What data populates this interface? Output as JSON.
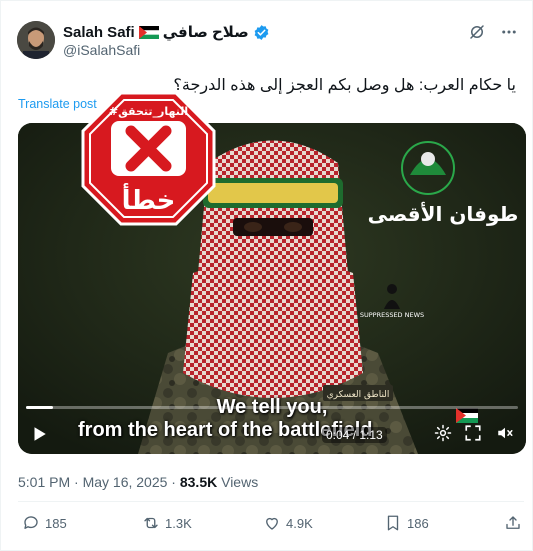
{
  "author": {
    "display_name": "Salah Safi",
    "arabic_name": "صلاح صافي",
    "handle": "@iSalahSafi",
    "verified": true,
    "flag_icon": "palestine-flag-icon"
  },
  "post": {
    "text": "يا حكام العرب: هل وصل بكم العجز إلى هذه الدرجة؟",
    "translate_label": "Translate post",
    "timestamp": "5:01 PM · May 16, 2025 ·",
    "views_count": "83.5K",
    "views_label": "Views"
  },
  "media": {
    "stamp_text_top": "#النهار_تتحقق",
    "stamp_text_bottom": "خطأ",
    "logo_text": "طوفان الأقصى",
    "watermark_text": "SUPPRESSED NEWS",
    "badge_text": "الناطق العسكري",
    "subtitle_line1": "We tell you,",
    "subtitle_line2": "from the heart of the battlefield",
    "time_display": "0:04 / 1:13",
    "progress": 0.055
  },
  "actions": {
    "replies": "185",
    "reposts": "1.3K",
    "likes": "4.9K",
    "bookmarks": "186"
  },
  "colors": {
    "accent": "#1d9bf0",
    "stamp_red": "#d7191f",
    "text_secondary": "#536471"
  }
}
